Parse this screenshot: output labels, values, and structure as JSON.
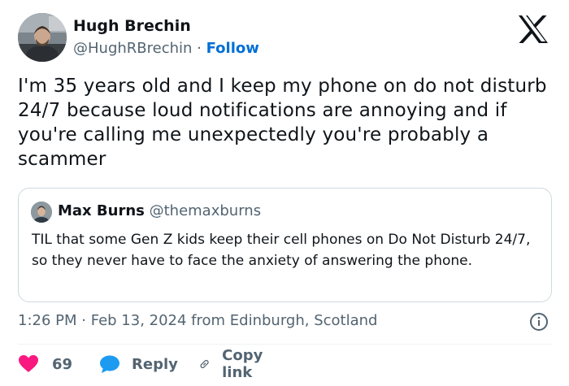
{
  "author": {
    "name": "Hugh Brechin",
    "handle": "@HughRBrechin",
    "separator": " · ",
    "follow_label": "Follow"
  },
  "tweet": {
    "text": "I'm 35 years old and I keep my phone on do not disturb 24/7 because loud notifications are annoying and if you're calling me unexpectedly you're probably a scammer"
  },
  "quote": {
    "name": "Max Burns",
    "handle": "@themaxburns",
    "text": "TIL that some Gen Z kids keep their cell phones on Do Not Disturb 24/7, so they never have to face the anxiety of answering the phone."
  },
  "meta": {
    "time": "1:26 PM",
    "separator": " · ",
    "date": "Feb 13, 2024",
    "location": " from Edinburgh, Scotland"
  },
  "actions": {
    "likes_count": "69",
    "reply_label": "Reply",
    "copy_link_label": "Copy link"
  },
  "colors": {
    "like_heart": "#f91880",
    "reply_bubble": "#1d9bf0",
    "follow_link": "#006fd6",
    "secondary_text": "#536471"
  },
  "icons": {
    "brand": "x-logo-icon",
    "info": "info-icon",
    "like": "heart-icon",
    "reply": "speech-bubble-icon",
    "copy": "link-icon"
  }
}
